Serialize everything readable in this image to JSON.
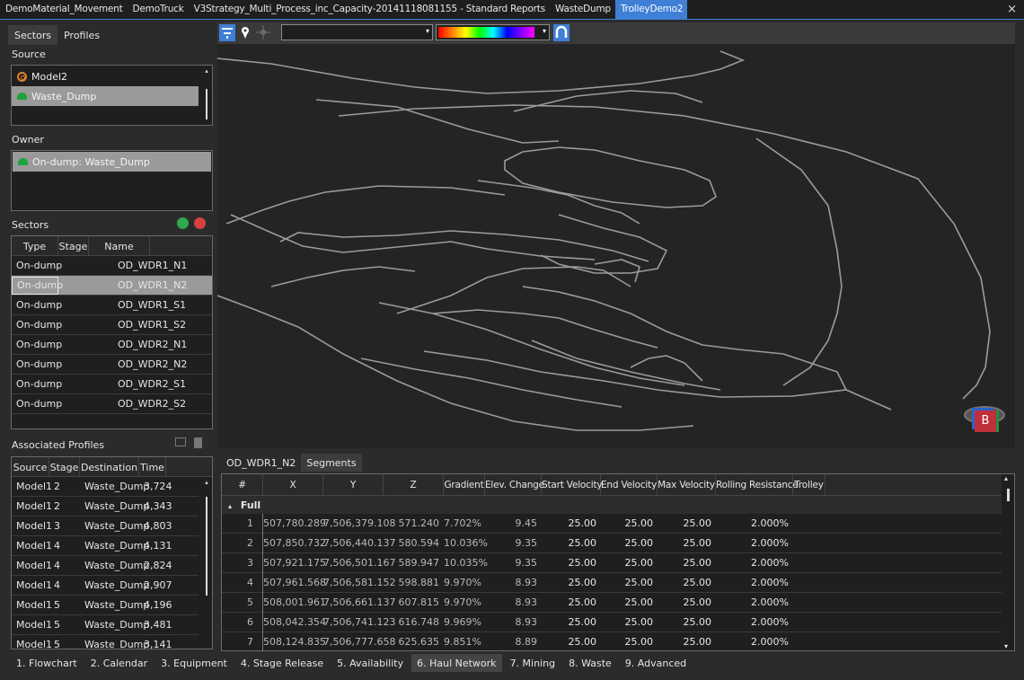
{
  "doc_tabs": [
    "DemoMaterial_Movement",
    "DemoTruck",
    "V3Strategy_Multi_Process_inc_Capacity-20141118081155 - Standard Reports",
    "WasteDump",
    "TrolleyDemo2"
  ],
  "doc_close": "×",
  "left_tabs": [
    "Sectors",
    "Profiles"
  ],
  "source": {
    "label": "Source",
    "items": [
      {
        "name": "Model2",
        "icon": "model-icon"
      },
      {
        "name": "Waste_Dump",
        "icon": "dump-icon"
      }
    ]
  },
  "owner": {
    "label": "Owner",
    "items": [
      {
        "name": "On-dump: Waste_Dump",
        "icon": "dump-icon"
      }
    ]
  },
  "sectors": {
    "label": "Sectors",
    "columns": [
      "Type",
      "Stage",
      "Name"
    ],
    "rows": [
      {
        "type": "On-dump",
        "stage": "",
        "name": "OD_WDR1_N1"
      },
      {
        "type": "On-dump",
        "stage": "",
        "name": "OD_WDR1_N2"
      },
      {
        "type": "On-dump",
        "stage": "",
        "name": "OD_WDR1_S1"
      },
      {
        "type": "On-dump",
        "stage": "",
        "name": "OD_WDR1_S2"
      },
      {
        "type": "On-dump",
        "stage": "",
        "name": "OD_WDR2_N1"
      },
      {
        "type": "On-dump",
        "stage": "",
        "name": "OD_WDR2_N2"
      },
      {
        "type": "On-dump",
        "stage": "",
        "name": "OD_WDR2_S1"
      },
      {
        "type": "On-dump",
        "stage": "",
        "name": "OD_WDR2_S2"
      }
    ]
  },
  "associated": {
    "label": "Associated Profiles",
    "columns": [
      "Source",
      "Stage",
      "Destination",
      "Time"
    ],
    "rows": [
      {
        "source": "Model1",
        "stage": "2",
        "destination": "Waste_Dump",
        "time": "3,724"
      },
      {
        "source": "Model1",
        "stage": "2",
        "destination": "Waste_Dump",
        "time": "4,343"
      },
      {
        "source": "Model1",
        "stage": "3",
        "destination": "Waste_Dump",
        "time": "4,803"
      },
      {
        "source": "Model1",
        "stage": "4",
        "destination": "Waste_Dump",
        "time": "4,131"
      },
      {
        "source": "Model1",
        "stage": "4",
        "destination": "Waste_Dump",
        "time": "2,824"
      },
      {
        "source": "Model1",
        "stage": "4",
        "destination": "Waste_Dump",
        "time": "2,907"
      },
      {
        "source": "Model1",
        "stage": "5",
        "destination": "Waste_Dump",
        "time": "4,196"
      },
      {
        "source": "Model1",
        "stage": "5",
        "destination": "Waste_Dump",
        "time": "3,481"
      },
      {
        "source": "Model1",
        "stage": "5",
        "destination": "Waste_Dump",
        "time": "3,141"
      }
    ]
  },
  "viewer": {
    "nav_cube_label": "B"
  },
  "bottom_tabs": [
    "OD_WDR1_N2",
    "Segments"
  ],
  "segments": {
    "columns": [
      "#",
      "X",
      "Y",
      "Z",
      "Gradient",
      "Elev. Change",
      "Start Velocity",
      "End Velocity",
      "Max Velocity",
      "Rolling Resistance",
      "Trolley"
    ],
    "group": "Full",
    "group_toggle": "▴",
    "rows": [
      {
        "n": "1",
        "x": "507,780.289",
        "y": "7,506,379.108",
        "z": "571.240",
        "gradient": "7.702%",
        "elev": "9.45",
        "start_v": "25.00",
        "end_v": "25.00",
        "max_v": "25.00",
        "rr": "2.000%",
        "trolley": ""
      },
      {
        "n": "2",
        "x": "507,850.732",
        "y": "7,506,440.137",
        "z": "580.594",
        "gradient": "10.036%",
        "elev": "9.35",
        "start_v": "25.00",
        "end_v": "25.00",
        "max_v": "25.00",
        "rr": "2.000%",
        "trolley": ""
      },
      {
        "n": "3",
        "x": "507,921.175",
        "y": "7,506,501.167",
        "z": "589.947",
        "gradient": "10.035%",
        "elev": "9.35",
        "start_v": "25.00",
        "end_v": "25.00",
        "max_v": "25.00",
        "rr": "2.000%",
        "trolley": ""
      },
      {
        "n": "4",
        "x": "507,961.568",
        "y": "7,506,581.152",
        "z": "598.881",
        "gradient": "9.970%",
        "elev": "8.93",
        "start_v": "25.00",
        "end_v": "25.00",
        "max_v": "25.00",
        "rr": "2.000%",
        "trolley": ""
      },
      {
        "n": "5",
        "x": "508,001.961",
        "y": "7,506,661.137",
        "z": "607.815",
        "gradient": "9.970%",
        "elev": "8.93",
        "start_v": "25.00",
        "end_v": "25.00",
        "max_v": "25.00",
        "rr": "2.000%",
        "trolley": ""
      },
      {
        "n": "6",
        "x": "508,042.354",
        "y": "7,506,741.123",
        "z": "616.748",
        "gradient": "9.969%",
        "elev": "8.93",
        "start_v": "25.00",
        "end_v": "25.00",
        "max_v": "25.00",
        "rr": "2.000%",
        "trolley": ""
      },
      {
        "n": "7",
        "x": "508,124.835",
        "y": "7,506,777.658",
        "z": "625.635",
        "gradient": "9.851%",
        "elev": "8.89",
        "start_v": "25.00",
        "end_v": "25.00",
        "max_v": "25.00",
        "rr": "2.000%",
        "trolley": ""
      }
    ]
  },
  "footer_tabs": [
    "1. Flowchart",
    "2. Calendar",
    "3. Equipment",
    "4. Stage Release",
    "5. Availability",
    "6. Haul Network",
    "7. Mining",
    "8. Waste",
    "9. Advanced"
  ],
  "active_footer": "6. Haul Network",
  "colors": {
    "accent": "#3f7fd6",
    "add": "#2fa84f",
    "remove": "#d84040",
    "selected_row": "#9a9a9a"
  }
}
